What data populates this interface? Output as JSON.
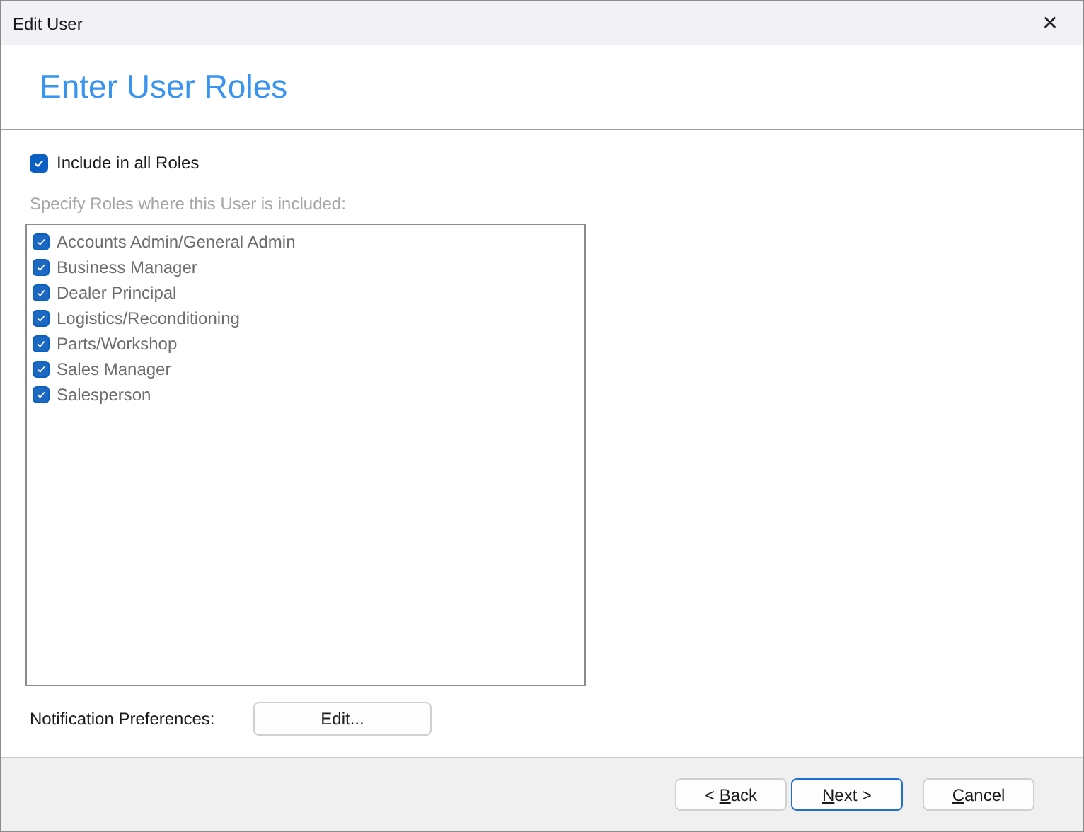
{
  "window": {
    "title": "Edit User",
    "close": "✕"
  },
  "header": {
    "title": "Enter User Roles"
  },
  "include_all": {
    "label": "Include in all Roles",
    "checked": true
  },
  "roles_caption": "Specify Roles where this User is included:",
  "roles_list": {
    "disabled": true,
    "items": [
      {
        "label": "Accounts Admin/General Admin",
        "checked": true
      },
      {
        "label": "Business Manager",
        "checked": true
      },
      {
        "label": "Dealer Principal",
        "checked": true
      },
      {
        "label": "Logistics/Reconditioning",
        "checked": true
      },
      {
        "label": "Parts/Workshop",
        "checked": true
      },
      {
        "label": "Sales Manager",
        "checked": true
      },
      {
        "label": "Salesperson",
        "checked": true
      }
    ]
  },
  "notification": {
    "label": "Notification Preferences:",
    "button": "Edit..."
  },
  "buttons": [
    {
      "before": "< ",
      "access_key": "B",
      "after": "ack",
      "default": false
    },
    {
      "access_key": "N",
      "after": "ext >",
      "default": true
    },
    {
      "access_key": "C",
      "after": "ancel",
      "default": false
    }
  ]
}
